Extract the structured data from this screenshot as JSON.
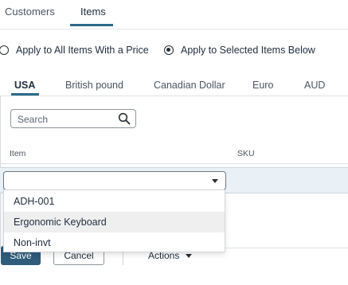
{
  "top_tabs": [
    {
      "label": "Customers",
      "active": false
    },
    {
      "label": "Items",
      "active": true
    }
  ],
  "apply_options": [
    {
      "label": "Apply to All Items With a Price",
      "checked": false
    },
    {
      "label": "Apply to Selected Items Below",
      "checked": true
    }
  ],
  "currency_tabs": [
    {
      "label": "USA",
      "active": true
    },
    {
      "label": "British pound",
      "active": false
    },
    {
      "label": "Canadian Dollar",
      "active": false
    },
    {
      "label": "Euro",
      "active": false
    },
    {
      "label": "AUD",
      "active": false
    }
  ],
  "search": {
    "placeholder": "Search",
    "icon": "search-icon"
  },
  "table": {
    "columns": [
      "Item",
      "SKU"
    ],
    "item_select": {
      "value": "",
      "icon": "chevron-down-icon"
    }
  },
  "dropdown": {
    "options": [
      "ADH-001",
      "Ergonomic Keyboard",
      "Non-invt"
    ],
    "highlighted": "Ergonomic Keyboard"
  },
  "footer": {
    "save_label": "Save",
    "cancel_label": "Cancel",
    "actions_label": "Actions"
  },
  "colors": {
    "accent": "#2b6a8a",
    "primary_button": "#2f5c7a",
    "row_selected": "#e9f1f6"
  }
}
